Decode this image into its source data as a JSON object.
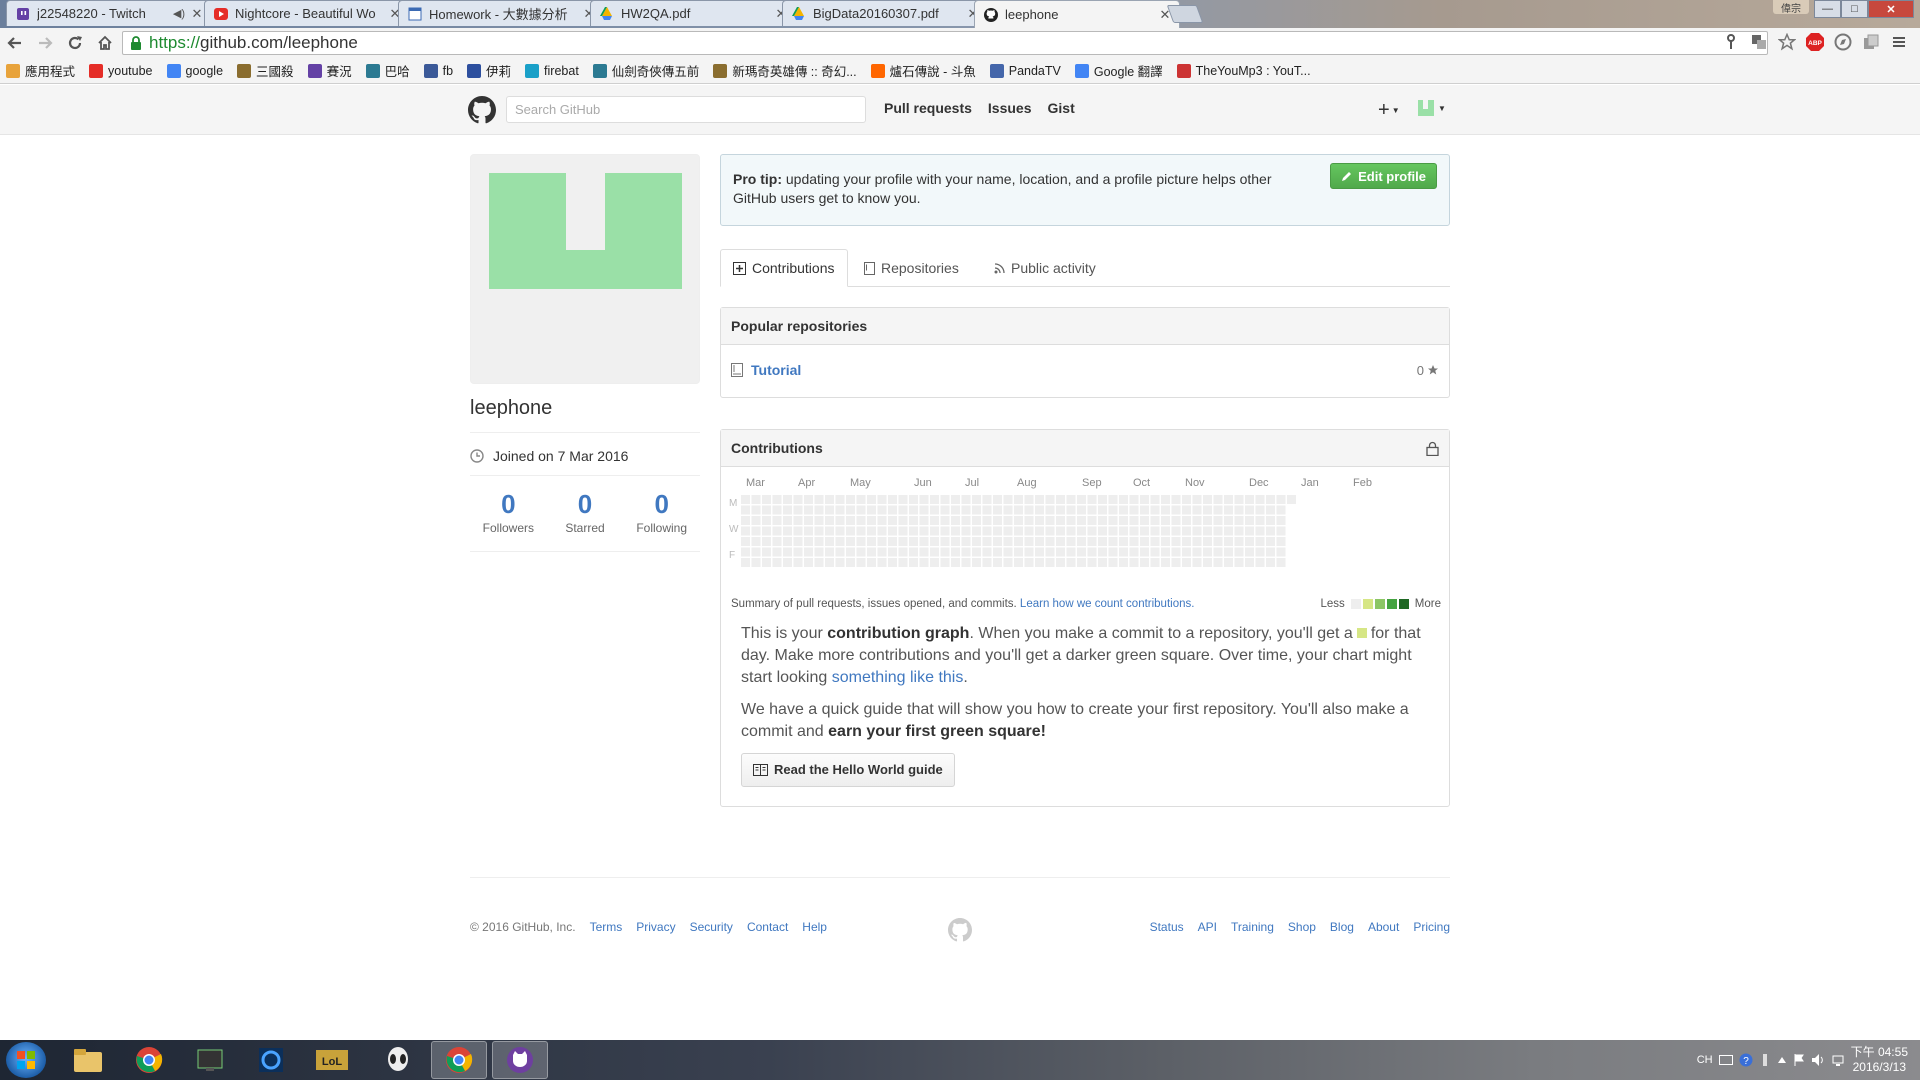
{
  "browser": {
    "tabs": [
      {
        "title": "j22548220 - Twitch",
        "icon": "twitch-icon",
        "audio": true
      },
      {
        "title": "Nightcore - Beautiful Wo",
        "icon": "youtube-icon"
      },
      {
        "title": "Homework - 大數據分析",
        "icon": "doc-icon"
      },
      {
        "title": "HW2QA.pdf",
        "icon": "drive-icon"
      },
      {
        "title": "BigData20160307.pdf",
        "icon": "drive-icon"
      },
      {
        "title": "leephone",
        "icon": "github-icon",
        "active": true
      }
    ],
    "profile_name": "偉宗",
    "url_scheme": "https://",
    "url_host": "github.com/leephone",
    "bookmarks": [
      {
        "label": "應用程式",
        "icon": "apps-icon"
      },
      {
        "label": "youtube",
        "icon": "youtube-icon"
      },
      {
        "label": "google",
        "icon": "google-icon"
      },
      {
        "label": "三國殺",
        "icon": "game-icon"
      },
      {
        "label": "賽況",
        "icon": "twitch-icon"
      },
      {
        "label": "巴哈",
        "icon": "bahamut-icon"
      },
      {
        "label": "fb",
        "icon": "facebook-icon"
      },
      {
        "label": "伊莉",
        "icon": "eyny-icon"
      },
      {
        "label": "firebat",
        "icon": "firebat-icon"
      },
      {
        "label": "仙劍奇俠傳五前",
        "icon": "bahamut-icon"
      },
      {
        "label": "新瑪奇英雄傳 :: 奇幻...",
        "icon": "game-icon"
      },
      {
        "label": "爐石傳說 - 斗魚",
        "icon": "douyu-icon"
      },
      {
        "label": "PandaTV",
        "icon": "panda-icon"
      },
      {
        "label": "Google 翻譯",
        "icon": "translate-icon"
      },
      {
        "label": "TheYouMp3 : YouT...",
        "icon": "chart-icon"
      }
    ]
  },
  "github": {
    "search_placeholder": "Search GitHub",
    "nav": [
      "Pull requests",
      "Issues",
      "Gist"
    ],
    "plus": "+",
    "profile": {
      "username": "leephone",
      "joined": "Joined on 7 Mar 2016",
      "stats": [
        {
          "value": "0",
          "label": "Followers"
        },
        {
          "value": "0",
          "label": "Starred"
        },
        {
          "value": "0",
          "label": "Following"
        }
      ]
    },
    "protip": {
      "bold": "Pro tip:",
      "text": "updating your profile with your name, location, and a profile picture helps other GitHub users get to know you.",
      "button": "Edit profile"
    },
    "tabs": [
      "Contributions",
      "Repositories",
      "Public activity"
    ],
    "popular": {
      "heading": "Popular repositories",
      "repos": [
        {
          "name": "Tutorial",
          "stars": "0"
        }
      ]
    },
    "contributions": {
      "heading": "Contributions",
      "months": [
        "Mar",
        "Apr",
        "May",
        "Jun",
        "Jul",
        "Aug",
        "Sep",
        "Oct",
        "Nov",
        "Dec",
        "Jan",
        "Feb"
      ],
      "days": [
        "M",
        "W",
        "F"
      ],
      "summary": "Summary of pull requests, issues opened, and commits.",
      "learn_link": "Learn how we count contributions.",
      "less": "Less",
      "more": "More",
      "legend_colors": [
        "#eeeeee",
        "#d6e685",
        "#8cc665",
        "#44a340",
        "#1e6823"
      ],
      "empty_color": "#eeeeee"
    },
    "graph_text": {
      "p1_a": "This is your",
      "p1_b": "contribution graph",
      "p1_c": ". When you make a commit to a repository, you'll get a",
      "p1_d": "for that day. Make more contributions and you'll get a darker green square. Over time, your chart might start looking",
      "p1_link": "something like this",
      "p1_e": ".",
      "p2_a": "We have a quick guide that will show you how to create your first repository. You'll also make a commit and",
      "p2_b": "earn your first green square!",
      "button": "Read the Hello World guide"
    },
    "footer": {
      "copyright": "© 2016 GitHub, Inc.",
      "left_links": [
        "Terms",
        "Privacy",
        "Security",
        "Contact",
        "Help"
      ],
      "right_links": [
        "Status",
        "API",
        "Training",
        "Shop",
        "Blog",
        "About",
        "Pricing"
      ]
    }
  },
  "taskbar": {
    "lang": "CH",
    "time": "下午 04:55",
    "date": "2016/3/13"
  },
  "colors": {
    "link": "#4078c0",
    "avatar_green": "#9ae0a7",
    "edit_green": "#55ae50"
  }
}
